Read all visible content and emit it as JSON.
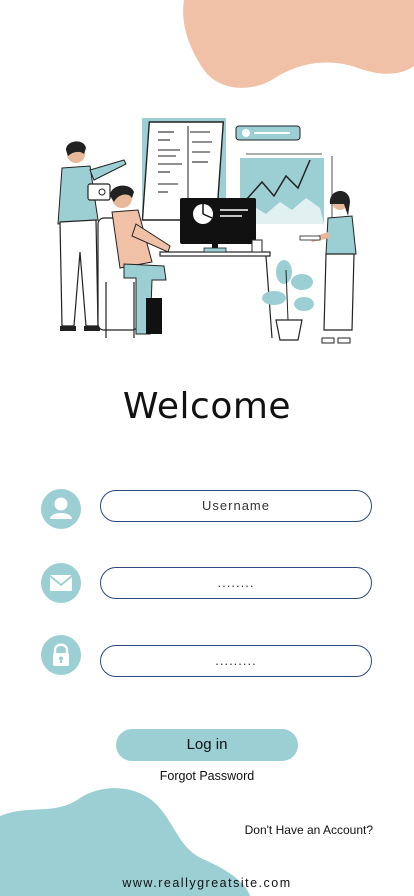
{
  "header": {
    "title": "Welcome"
  },
  "form": {
    "username": {
      "value": "Username"
    },
    "email": {
      "value": "........"
    },
    "password": {
      "value": "........."
    }
  },
  "actions": {
    "login_label": "Log in",
    "forgot_label": "Forgot Password",
    "signup_label": "Don't Have an Account?"
  },
  "footer": {
    "site": "www.reallygreatsite.com"
  },
  "icons": {
    "username": "user-icon",
    "email": "mail-icon",
    "password": "lock-icon"
  },
  "colors": {
    "accent": "#9ccfd4",
    "blob_top": "#f1c1a7",
    "field_border": "#2e4a7a"
  }
}
